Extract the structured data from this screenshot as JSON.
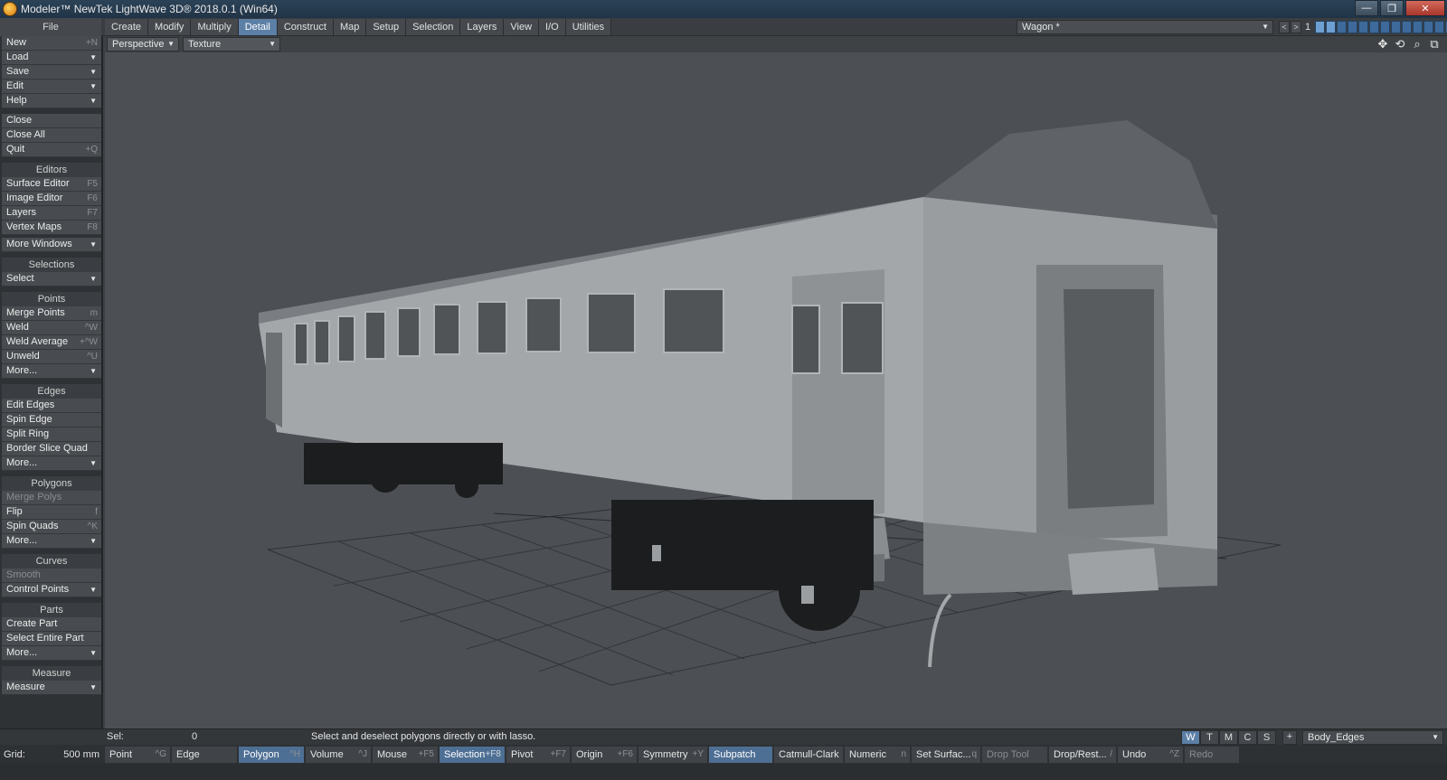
{
  "window": {
    "title": "Modeler™ NewTek LightWave 3D® 2018.0.1 (Win64)",
    "controls": {
      "minimize": "—",
      "maximize": "❐",
      "close": "✕"
    }
  },
  "menubar": {
    "file_header": "File",
    "tabs": [
      {
        "label": "Create"
      },
      {
        "label": "Modify"
      },
      {
        "label": "Multiply"
      },
      {
        "label": "Detail",
        "active": true
      },
      {
        "label": "Construct"
      },
      {
        "label": "Map"
      },
      {
        "label": "Setup"
      },
      {
        "label": "Selection"
      },
      {
        "label": "Layers"
      },
      {
        "label": "View"
      },
      {
        "label": "I/O"
      },
      {
        "label": "Utilities"
      }
    ],
    "object_name": "Wagon *",
    "layer_prev": "<",
    "layer_next": ">",
    "layer_number": "1"
  },
  "sidebar": {
    "file_items": [
      {
        "label": "New",
        "shortcut": "+N"
      },
      {
        "label": "Load",
        "dropdown": true
      },
      {
        "label": "Save",
        "dropdown": true
      },
      {
        "label": "Edit",
        "dropdown": true
      },
      {
        "label": "Help",
        "dropdown": true
      }
    ],
    "close_items": [
      {
        "label": "Close"
      },
      {
        "label": "Close All"
      },
      {
        "label": "Quit",
        "shortcut": "+Q"
      }
    ],
    "editors": {
      "header": "Editors",
      "items": [
        {
          "label": "Surface Editor",
          "shortcut": "F5"
        },
        {
          "label": "Image Editor",
          "shortcut": "F6"
        },
        {
          "label": "Layers",
          "shortcut": "F7"
        },
        {
          "label": "Vertex Maps",
          "shortcut": "F8"
        }
      ],
      "more": "More Windows"
    },
    "selections": {
      "header": "Selections",
      "item": "Select"
    },
    "points": {
      "header": "Points",
      "items": [
        {
          "label": "Merge Points",
          "shortcut": "m"
        },
        {
          "label": "Weld",
          "shortcut": "^W"
        },
        {
          "label": "Weld Average",
          "shortcut": "+^W"
        },
        {
          "label": "Unweld",
          "shortcut": "^U"
        }
      ],
      "more": "More..."
    },
    "edges": {
      "header": "Edges",
      "items": [
        {
          "label": "Edit Edges"
        },
        {
          "label": "Spin Edge"
        },
        {
          "label": "Split Ring"
        },
        {
          "label": "Border Slice Quad"
        }
      ],
      "more": "More..."
    },
    "polygons": {
      "header": "Polygons",
      "items": [
        {
          "label": "Merge Polys",
          "disabled": true
        },
        {
          "label": "Flip",
          "shortcut": "f"
        },
        {
          "label": "Spin Quads",
          "shortcut": "^K"
        }
      ],
      "more": "More..."
    },
    "curves": {
      "header": "Curves",
      "smooth": "Smooth",
      "control_points": "Control Points"
    },
    "parts": {
      "header": "Parts",
      "items": [
        {
          "label": "Create Part"
        },
        {
          "label": "Select Entire Part"
        }
      ],
      "more": "More..."
    },
    "measure": {
      "header": "Measure",
      "item": "Measure"
    }
  },
  "viewport": {
    "view_mode": "Perspective",
    "render_mode": "Texture"
  },
  "statusbar": {
    "sel_label": "Sel:",
    "sel_value": "0",
    "hint": "Select and deselect polygons directly or with lasso.",
    "wtmcs": [
      "W",
      "T",
      "M",
      "C",
      "S"
    ],
    "plus": "+",
    "surface": "Body_Edges"
  },
  "bottombar": {
    "grid_label": "Grid:",
    "grid_value": "500 mm",
    "buttons": [
      {
        "label": "Point",
        "shortcut": "^G"
      },
      {
        "label": "Edge",
        "shortcut": ""
      },
      {
        "label": "Polygon",
        "shortcut": "^H",
        "active": true
      },
      {
        "label": "Volume",
        "shortcut": "^J"
      },
      {
        "label": "Mouse",
        "shortcut": "+F5"
      },
      {
        "label": "Selection",
        "shortcut": "+F8",
        "active": true
      },
      {
        "label": "Pivot",
        "shortcut": "+F7"
      },
      {
        "label": "Origin",
        "shortcut": "+F6"
      },
      {
        "label": "Symmetry",
        "shortcut": "+Y"
      },
      {
        "label": "Subpatch",
        "shortcut": "",
        "active": true
      },
      {
        "label": "Catmull-Clark",
        "shortcut": ""
      },
      {
        "label": "Numeric",
        "shortcut": "n"
      },
      {
        "label": "Set Surfac...",
        "shortcut": "q"
      },
      {
        "label": "Drop Tool",
        "shortcut": "",
        "disabled": true
      },
      {
        "label": "Drop/Rest...",
        "shortcut": "/"
      },
      {
        "label": "Undo",
        "shortcut": "^Z"
      },
      {
        "label": "Redo",
        "shortcut": "",
        "disabled": true
      }
    ]
  }
}
